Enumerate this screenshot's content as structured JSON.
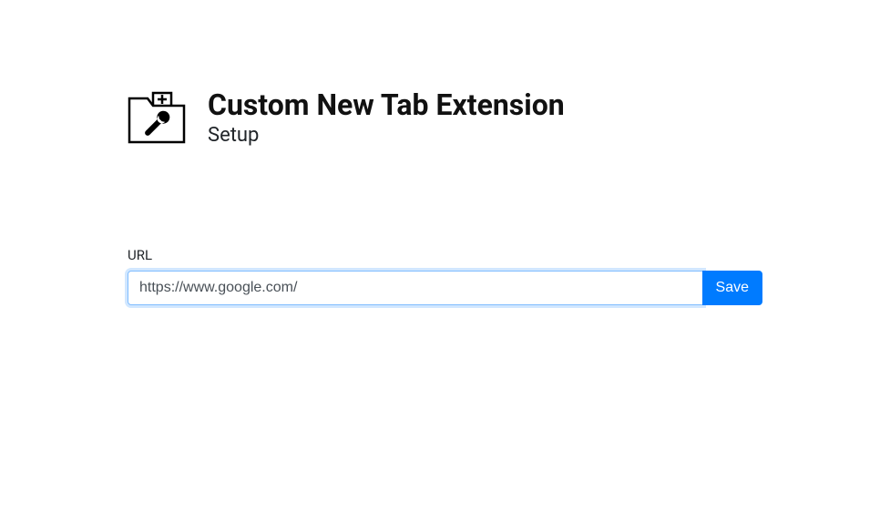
{
  "header": {
    "title": "Custom New Tab Extension",
    "subtitle": "Setup"
  },
  "form": {
    "url_label": "URL",
    "url_value": "https://www.google.com/",
    "save_label": "Save"
  }
}
